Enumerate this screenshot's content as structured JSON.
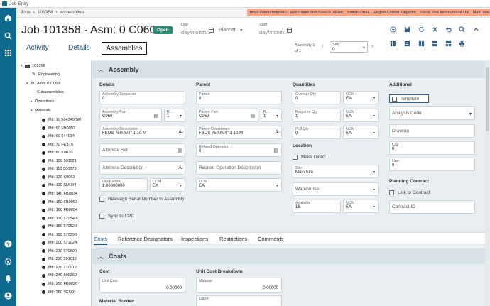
{
  "window": {
    "title": "Job Entry"
  },
  "breadcrumb": [
    "Jobs",
    "101358",
    "Assemblies"
  ],
  "env": {
    "url": "https://ukouthdtpilot01.epicorsaas.com/SaaS510Pilot",
    "user": "Simon.Orrell",
    "language": "English/United Kingdom",
    "company": "Steve Vick International Ltd",
    "site": "Main Site"
  },
  "header": {
    "title": "Job 101358 - Asm: 0 C060",
    "status": "Open",
    "due_label": "Due",
    "due_placeholder": "day/month...",
    "planner_label": "Planner",
    "start_label": "Start",
    "start_placeholder": "day/month..."
  },
  "tabs": {
    "activity": "Activity",
    "details": "Details",
    "assemblies": "Assemblies"
  },
  "asmnav": {
    "line1": "Assembly 1",
    "line2": "of 1"
  },
  "seq": {
    "label": "Seq",
    "value": "0"
  },
  "tree": {
    "root": "101358",
    "engineering": "Engineering",
    "asm": "Asm: 0 C060",
    "subassemblies": "Subassemblies",
    "operations": "Operations",
    "materials": "Materials",
    "mtls": [
      "Mtl: 10 504340/SR",
      "Mtl: 50 FB0052",
      "Mtl: 60 044014",
      "Mtl: 70 FK370",
      "Mtl: 80 K0020",
      "Mtl: 100 501121",
      "Mtl: 110 500379",
      "Mtl: 120 K0063",
      "Mtl: 130 SM094",
      "Mtl: 140 FB0034",
      "Mtl: 150 FB0053",
      "Mtl: 160 FB0054",
      "Mtl: 170 570540",
      "Mtl: 180 570520",
      "Mtl: 190 570390",
      "Mtl: 200 571024",
      "Mtl: 210 570590",
      "Mtl: 220 201012",
      "Mtl: 230 210012",
      "Mtl: 240 500360",
      "Mtl: 250 FB0026",
      "Mtl: 260 SF560"
    ]
  },
  "assembly": {
    "title": "Assembly",
    "details": {
      "heading": "Details",
      "asm_seq_label": "Assembly Sequence",
      "asm_seq": "0",
      "part_label": "Assembly Part",
      "part": "C060",
      "rev_label": "R...",
      "rev": "1",
      "desc_label": "Assembly Description",
      "desc": "FBOS 75mm/4\" 1-10 M",
      "attr_set": "Attribute Set",
      "attr_desc": "Attribute Description",
      "qty_label": "Qty/Parent",
      "qty": "1.00000000",
      "uom_label": "UOM",
      "uom": "EA",
      "reassign": "Reassign Serial Number to Assembly",
      "sync": "Sync to CPC"
    },
    "parent": {
      "heading": "Parent",
      "parent_label": "Parent",
      "parent": "0",
      "ppart_label": "Parent Part",
      "ppart": "C060",
      "prev_label": "R...",
      "prev": "1",
      "pdesc_label": "Parent Description",
      "pdesc": "FBOS 75mm/4\" 1-10 M",
      "relop_label": "Related Operation",
      "relop": "0",
      "relop_desc": "Related Operation Description",
      "uom_label": "UOM",
      "uom": "EA"
    },
    "quantities": {
      "heading": "Quantities",
      "overrun_label": "Overrun Qty",
      "overrun": "0",
      "required_label": "Required Qty",
      "required": "1",
      "pull_label": "Pull Qty",
      "pull": "0",
      "uom_label": "UOM",
      "uom": "EA",
      "location": "Location",
      "make_direct": "Make Direct",
      "site_label": "Site",
      "site": "Main Site",
      "warehouse": "Warehouse",
      "available_label": "Available",
      "available": "18"
    },
    "additional": {
      "heading": "Additional",
      "template": "Template",
      "analysis_code": "Analysis Code",
      "drawing": "Drawing",
      "call_label": "Call",
      "call": "0",
      "line_label": "Line",
      "line": "0",
      "planning_contract": "Planning Contract",
      "link_to_contract": "Link to Contract",
      "contract_id": "Contract ID"
    }
  },
  "subtabs": [
    "Costs",
    "Reference Designators",
    "Inspections",
    "Restrictions",
    "Comments"
  ],
  "costs": {
    "title": "Costs",
    "cost_heading": "Cost",
    "unit_cost_label": "Unit Cost",
    "unit_cost": "0.00000",
    "breakdown_heading": "Unit Cost Breakdown",
    "material_label": "Material",
    "material": "0.00000",
    "labor_label": "Labor",
    "material_burden": "Material Burden"
  }
}
